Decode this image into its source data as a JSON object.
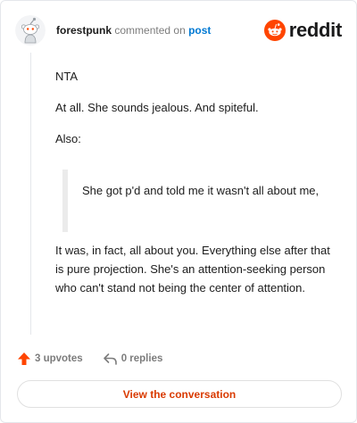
{
  "comment": {
    "author": "forestpunk",
    "commented_text": "commented on",
    "post_link": "post",
    "paragraphs_before_quote": [
      "NTA",
      "At all. She sounds jealous. And spiteful.",
      "Also:"
    ],
    "quote": "She got p'd and told me it wasn't all about me,",
    "paragraphs_after_quote": [
      "It was, in fact, all about you. Everything else after that is pure projection. She's an attention-seeking person who can't stand not being the center of attention."
    ]
  },
  "brand": {
    "name": "reddit",
    "color": "#ff4500"
  },
  "actions": {
    "upvotes": "3 upvotes",
    "replies": "0 replies"
  },
  "cta": {
    "label": "View the conversation",
    "color": "#d93a00"
  },
  "icons": {
    "avatar": "snoo-avatar",
    "brand": "reddit-snoo-icon",
    "upvote": "upvote-arrow-icon",
    "reply": "reply-arrow-icon"
  }
}
